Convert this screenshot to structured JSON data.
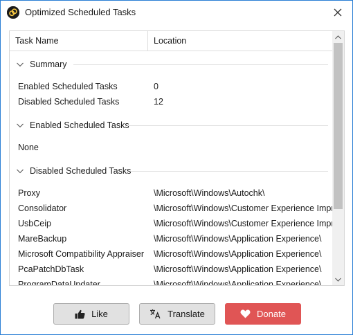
{
  "window": {
    "title": "Optimized Scheduled Tasks",
    "icon": "app-logo-icon",
    "close_icon": "close-icon"
  },
  "table": {
    "columns": [
      "Task Name",
      "Location"
    ],
    "groups": [
      {
        "title": "Summary",
        "rows": [
          {
            "name": "Enabled Scheduled Tasks",
            "location": "0"
          },
          {
            "name": "Disabled Scheduled Tasks",
            "location": "12"
          }
        ]
      },
      {
        "title": "Enabled Scheduled Tasks",
        "rows": [
          {
            "name": "None",
            "location": ""
          }
        ]
      },
      {
        "title": "Disabled Scheduled Tasks",
        "rows": [
          {
            "name": "Proxy",
            "location": "\\Microsoft\\Windows\\Autochk\\"
          },
          {
            "name": "Consolidator",
            "location": "\\Microsoft\\Windows\\Customer Experience Impr..."
          },
          {
            "name": "UsbCeip",
            "location": "\\Microsoft\\Windows\\Customer Experience Impr..."
          },
          {
            "name": "MareBackup",
            "location": "\\Microsoft\\Windows\\Application Experience\\"
          },
          {
            "name": "Microsoft Compatibility Appraiser",
            "location": "\\Microsoft\\Windows\\Application Experience\\"
          },
          {
            "name": "PcaPatchDbTask",
            "location": "\\Microsoft\\Windows\\Application Experience\\"
          },
          {
            "name": "ProgramDataUpdater",
            "location": "\\Microsoft\\Windows\\Application Experience\\"
          }
        ]
      }
    ]
  },
  "buttons": {
    "like": "Like",
    "translate": "Translate",
    "donate": "Donate"
  },
  "colors": {
    "accent_border": "#2a7fd4",
    "donate_bg": "#e05555"
  }
}
